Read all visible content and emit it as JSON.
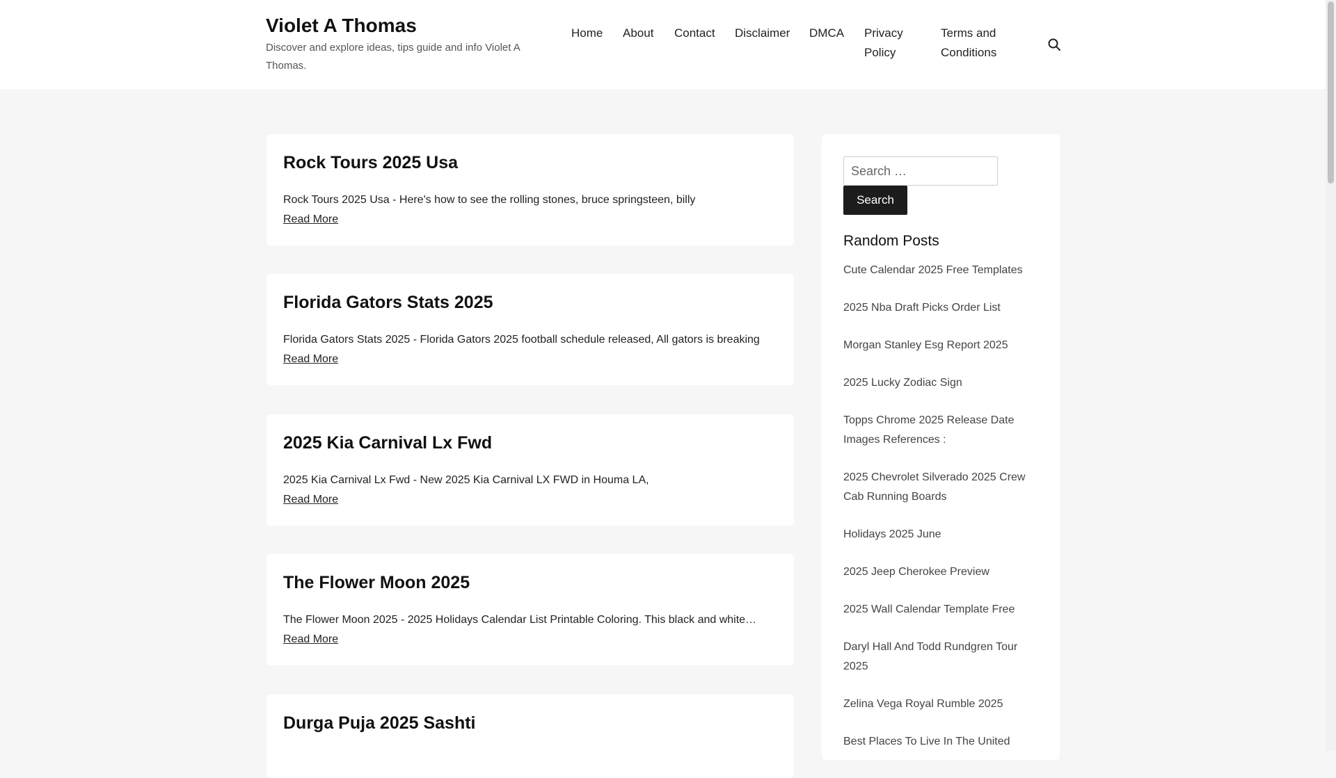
{
  "header": {
    "site_title": "Violet A Thomas",
    "site_description": "Discover and explore ideas, tips guide and info Violet A Thomas.",
    "nav": [
      {
        "label": "Home"
      },
      {
        "label": "About"
      },
      {
        "label": "Contact"
      },
      {
        "label": "Disclaimer"
      },
      {
        "label": "DMCA"
      },
      {
        "label": "Privacy Policy"
      },
      {
        "label": "Terms and Conditions"
      }
    ],
    "search_icon": "search-icon"
  },
  "posts": [
    {
      "title": "Rock Tours 2025 Usa",
      "excerpt": "Rock Tours 2025 Usa - Here's how to see the rolling stones, bruce springsteen, billy",
      "read_more": "Read More"
    },
    {
      "title": "Florida Gators Stats 2025",
      "excerpt": "Florida Gators Stats 2025 - Florida Gators 2025 football schedule released, All gators is breaking",
      "read_more": "Read More"
    },
    {
      "title": "2025 Kia Carnival Lx Fwd",
      "excerpt": "2025 Kia Carnival Lx Fwd - New 2025 Kia Carnival LX FWD in Houma LA,",
      "read_more": "Read More"
    },
    {
      "title": "The Flower Moon 2025",
      "excerpt": "The Flower Moon 2025 - 2025 Holidays Calendar List Printable Coloring. This black and white…",
      "read_more": "Read More"
    },
    {
      "title": "Durga Puja 2025 Sashti",
      "excerpt": "",
      "read_more": ""
    }
  ],
  "sidebar": {
    "search_placeholder": "Search …",
    "search_button": "Search",
    "random_title": "Random Posts",
    "random_posts": [
      "Cute Calendar 2025 Free Templates",
      "2025 Nba Draft Picks Order List",
      "Morgan Stanley Esg Report 2025",
      "2025 Lucky Zodiac Sign",
      "Topps Chrome 2025 Release Date Images References :",
      "2025 Chevrolet Silverado 2025 Crew Cab Running Boards",
      "Holidays 2025 June",
      "2025 Jeep Cherokee Preview",
      "2025 Wall Calendar Template Free",
      "Daryl Hall And Todd Rundgren Tour 2025",
      "Zelina Vega Royal Rumble 2025",
      "Best Places To Live In The United"
    ]
  },
  "colors": {
    "page_background": "#f6f6f6",
    "card_background": "#ffffff",
    "button_background": "#1c1c1c"
  }
}
